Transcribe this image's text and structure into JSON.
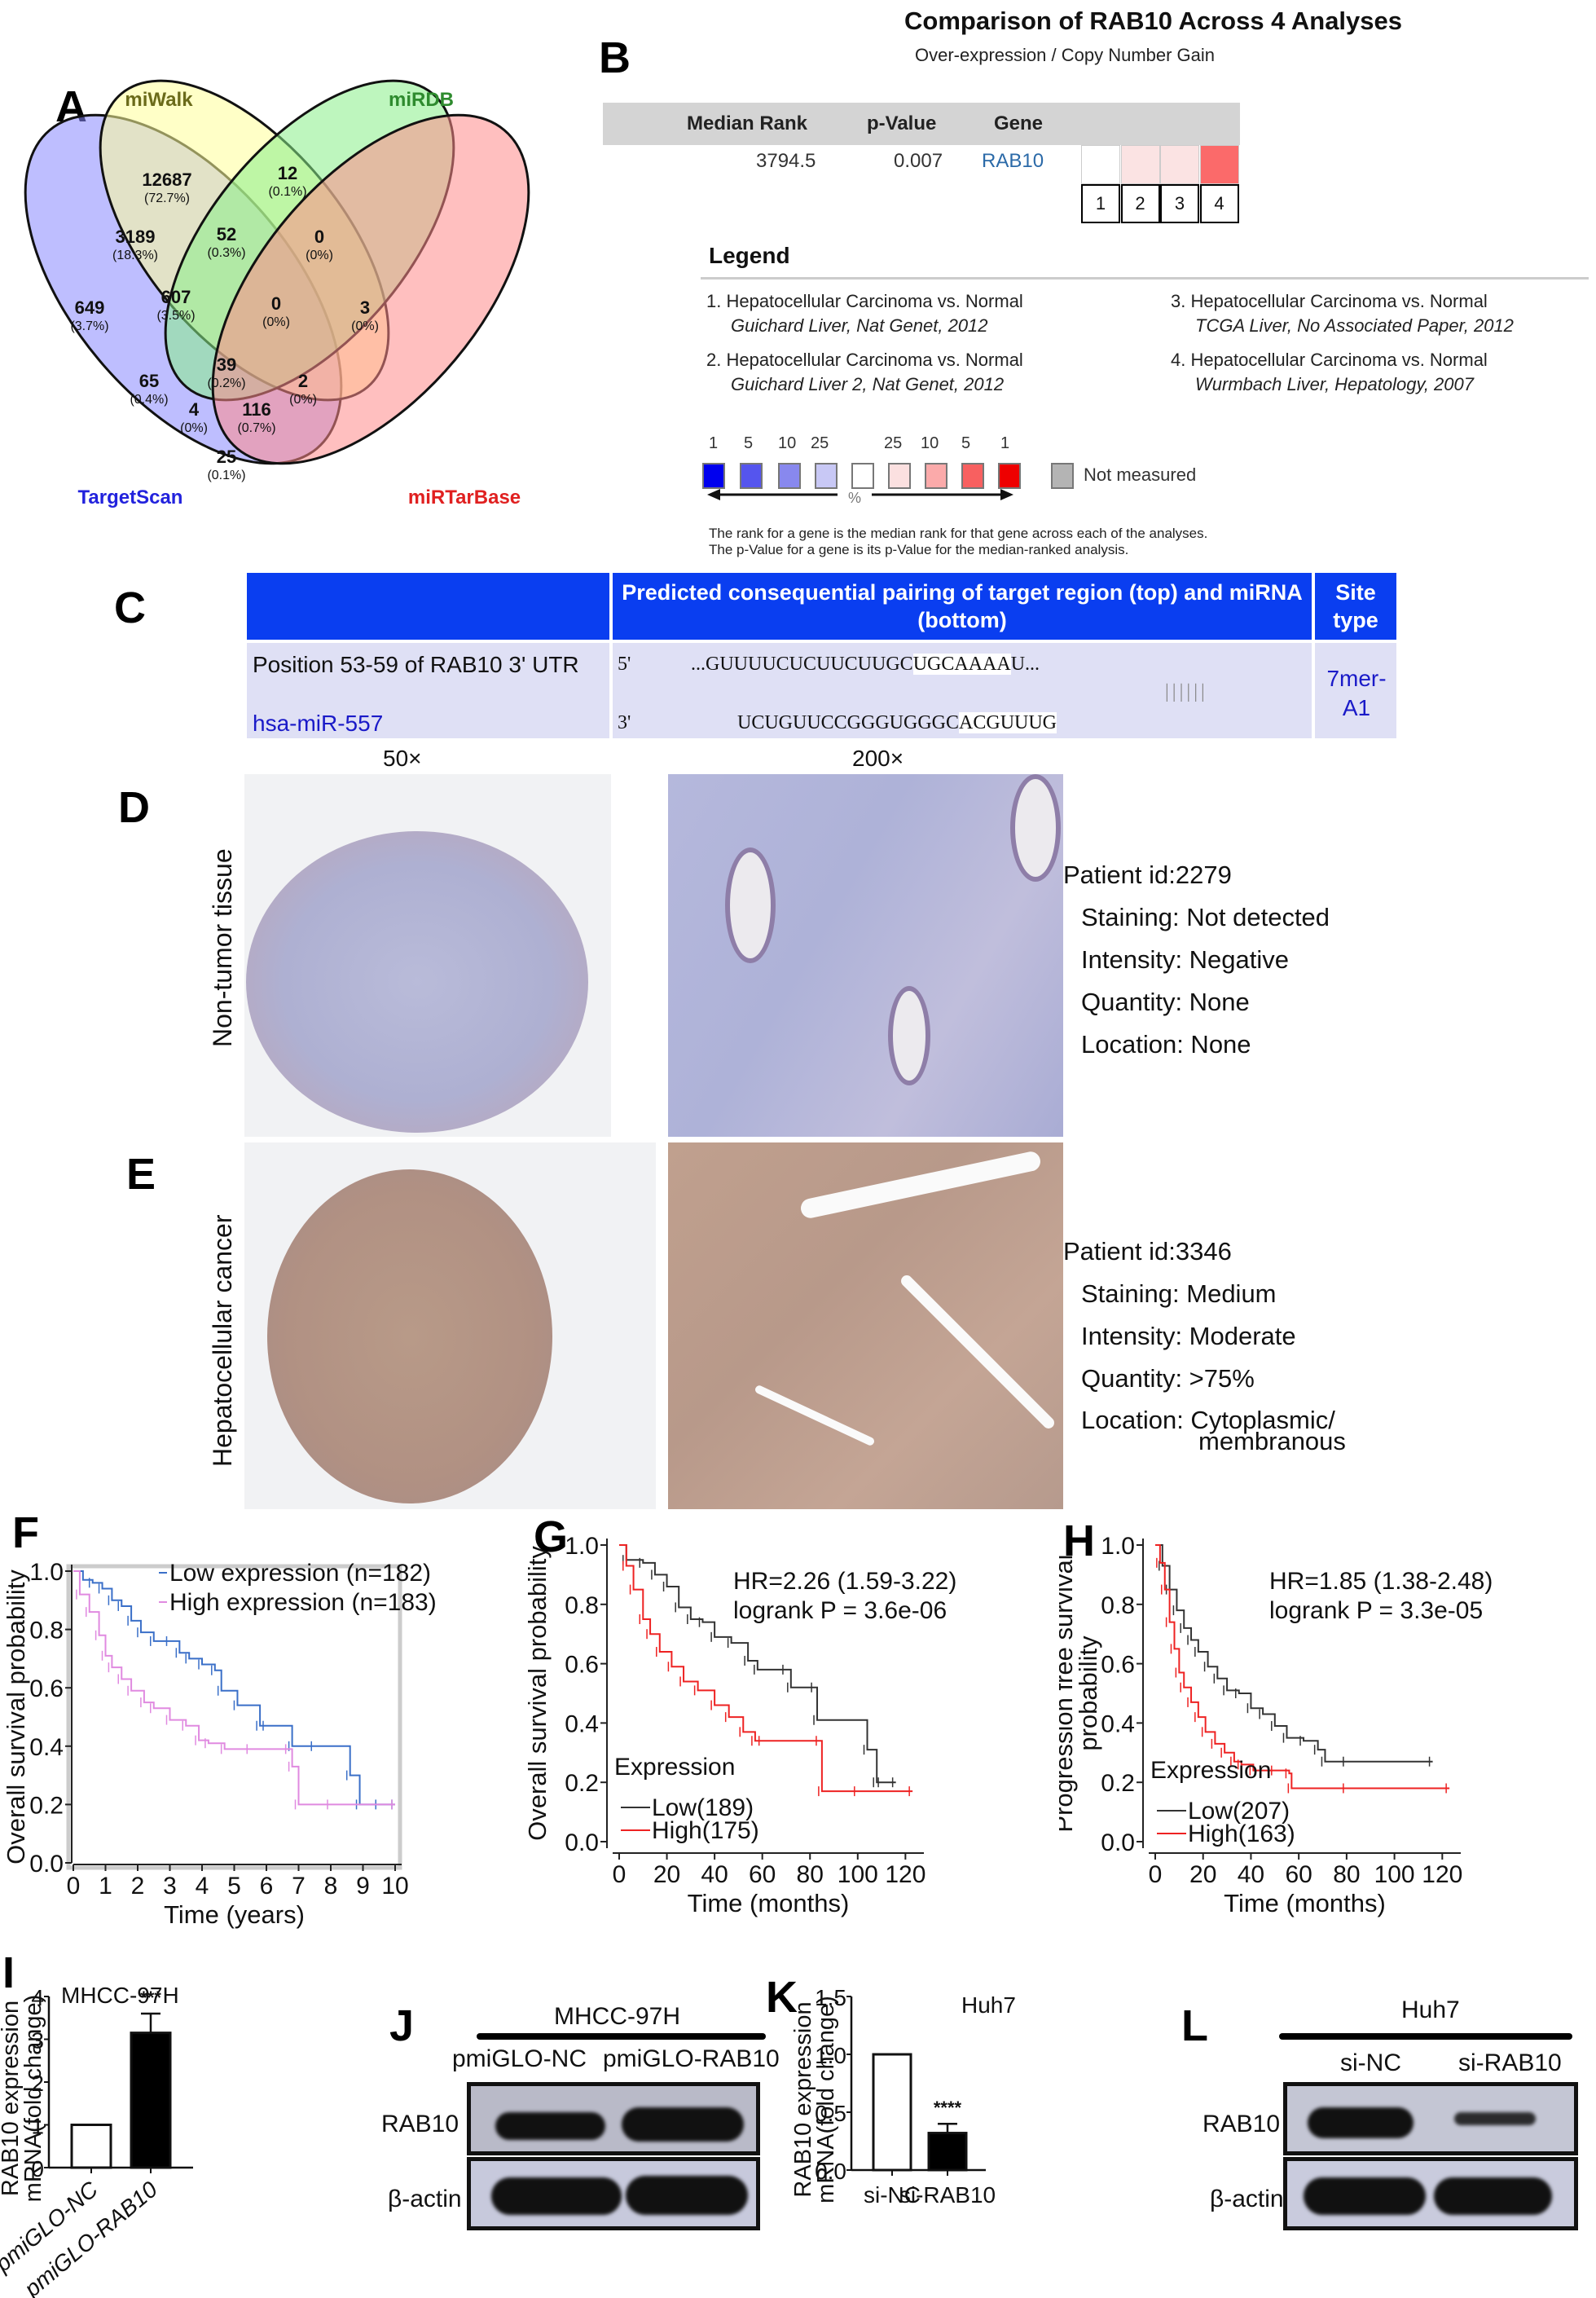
{
  "panel_labels": {
    "A": "A",
    "B": "B",
    "C": "C",
    "D": "D",
    "E": "E",
    "F": "F",
    "G": "G",
    "H": "H",
    "I": "I",
    "J": "J",
    "K": "K",
    "L": "L"
  },
  "venn": {
    "sets": [
      {
        "name": "miWalk",
        "color": "#ffff99",
        "label_color": "#6b6b1a"
      },
      {
        "name": "miRDB",
        "color": "#88ee88",
        "label_color": "#2e8b2e"
      },
      {
        "name": "TargetScan",
        "color": "#8888ff",
        "label_color": "#2222dd"
      },
      {
        "name": "miRTarBase",
        "color": "#ff8a8a",
        "label_color": "#e02020"
      }
    ],
    "regions": [
      {
        "sets": "miWalk only",
        "count": "12687",
        "pct": "(72.7%)"
      },
      {
        "sets": "miRDB only",
        "count": "12",
        "pct": "(0.1%)"
      },
      {
        "sets": "TargetScan only",
        "count": "649",
        "pct": "(3.7%)"
      },
      {
        "sets": "miRTarBase only",
        "count": "3",
        "pct": "(0%)"
      },
      {
        "sets": "TargetScan & miWalk",
        "count": "3189",
        "pct": "(18.3%)"
      },
      {
        "sets": "miWalk & miRDB",
        "count": "52",
        "pct": "(0.3%)"
      },
      {
        "sets": "miRDB & miRTarBase",
        "count": "0",
        "pct": "(0%)"
      },
      {
        "sets": "TargetScan & miWalk & miRDB",
        "count": "607",
        "pct": "(3.5%)"
      },
      {
        "sets": "miWalk & miRDB & miRTarBase",
        "count": "0",
        "pct": "(0%)"
      },
      {
        "sets": "all four",
        "count": "39",
        "pct": "(0.2%)"
      },
      {
        "sets": "TargetScan & miRDB",
        "count": "65",
        "pct": "(0.4%)"
      },
      {
        "sets": "miWalk & miRTarBase",
        "count": "2",
        "pct": "(0%)"
      },
      {
        "sets": "TargetScan & miRDB & miRTarBase",
        "count": "4",
        "pct": "(0%)"
      },
      {
        "sets": "TargetScan & miWalk & miRTarBase",
        "count": "116",
        "pct": "(0.7%)"
      },
      {
        "sets": "TargetScan & miRTarBase",
        "count": "25",
        "pct": "(0.1%)"
      }
    ]
  },
  "oncomine": {
    "title": "Comparison of RAB10 Across 4 Analyses",
    "subtitle": "Over-expression / Copy Number Gain",
    "headers": [
      "Median Rank",
      "p-Value",
      "Gene"
    ],
    "row": {
      "median_rank": "3794.5",
      "p_value": "0.007",
      "gene": "RAB10"
    },
    "cells": [
      {
        "n": "1",
        "color": "#ffffff"
      },
      {
        "n": "2",
        "color": "#fbe3e3"
      },
      {
        "n": "3",
        "color": "#fbe3e3"
      },
      {
        "n": "4",
        "color": "#fb6a6a"
      }
    ],
    "legend_title": "Legend",
    "analyses": [
      {
        "title": "1. Hepatocellular Carcinoma vs. Normal",
        "source": "Guichard Liver, Nat Genet, 2012"
      },
      {
        "title": "2. Hepatocellular Carcinoma vs. Normal",
        "source": "Guichard Liver 2, Nat Genet, 2012"
      },
      {
        "title": "3. Hepatocellular Carcinoma vs. Normal",
        "source": "TCGA Liver, No Associated Paper, 2012"
      },
      {
        "title": "4. Hepatocellular Carcinoma vs. Normal",
        "source": "Wurmbach Liver, Hepatology, 2007"
      }
    ],
    "scale_labels": [
      "1",
      "5",
      "10",
      "25",
      "25",
      "10",
      "5",
      "1"
    ],
    "scale_colors": [
      "#0000ee",
      "#5555ee",
      "#8888ee",
      "#c8c8f5",
      "#ffffff",
      "#fbe0e0",
      "#fbaaaa",
      "#f86060",
      "#ee0000"
    ],
    "not_measured_color": "#b4b4b4",
    "not_measured": "Not measured",
    "percent": "%",
    "note_line1": "The rank for a gene is the median rank for that gene across each of the analyses.",
    "note_line2": "The p-Value for a gene is its p-Value for the median-ranked analysis."
  },
  "targetscan": {
    "header_pairing": "Predicted consequential pairing of target region (top) and miRNA (bottom)",
    "header_site": "Site type",
    "position": "Position 53-59 of RAB10 3' UTR",
    "mirna": "hsa-miR-557",
    "five": "5'",
    "three": "3'",
    "target_pre": "...GUUUUCUCUUCUUGC",
    "target_hl": "UGCAAAA",
    "target_post": "U...",
    "mirna_pre": "UCUGUUCCGGGUGGGC",
    "mirna_hl": "ACGUUUG",
    "pairing": "||||||",
    "site_type": "7mer-A1"
  },
  "ihc": {
    "mag_low": "50×",
    "mag_high": "200×",
    "normal": {
      "row_label": "Non-tumor tissue",
      "patient": "Patient id:2279",
      "staining": "Staining: Not detected",
      "intensity": "Intensity: Negative",
      "quantity": "Quantity: None",
      "location": "Location: None"
    },
    "cancer": {
      "row_label": "Hepatocellular cancer",
      "patient": "Patient id:3346",
      "staining": "Staining: Medium",
      "intensity": "Intensity: Moderate",
      "quantity": "Quantity: >75%",
      "location": "Location: Cytoplasmic/",
      "location2": "membranous"
    }
  },
  "chart_data": [
    {
      "id": "F",
      "type": "line",
      "subtype": "kaplan-meier",
      "title": "",
      "xlabel": "Time (years)",
      "ylabel": "Overall survival probability",
      "xlim": [
        0,
        10
      ],
      "ylim": [
        0,
        1
      ],
      "xticks": [
        "0",
        "1",
        "2",
        "3",
        "4",
        "5",
        "6",
        "7",
        "8",
        "9",
        "10"
      ],
      "yticks": [
        "0.0",
        "0.2",
        "0.4",
        "0.6",
        "0.8",
        "1.0"
      ],
      "legend_position": "top-right",
      "series": [
        {
          "name": "Low expression (n=182)",
          "color": "#3a6fc8",
          "x": [
            0,
            0.3,
            0.6,
            0.9,
            1.2,
            1.5,
            1.8,
            2.1,
            2.5,
            3.0,
            3.3,
            3.6,
            4.0,
            4.4,
            4.6,
            5.1,
            5.8,
            6.0,
            6.8,
            7.5,
            8.6,
            8.9,
            9.5,
            10
          ],
          "y": [
            1.0,
            0.97,
            0.96,
            0.94,
            0.9,
            0.88,
            0.83,
            0.79,
            0.76,
            0.76,
            0.72,
            0.7,
            0.68,
            0.66,
            0.59,
            0.54,
            0.47,
            0.47,
            0.4,
            0.4,
            0.3,
            0.2,
            0.2,
            0.2
          ]
        },
        {
          "name": "High expression (n=183)",
          "color": "#e08ae0",
          "x": [
            0,
            0.2,
            0.5,
            0.8,
            1.0,
            1.2,
            1.5,
            1.8,
            2.2,
            2.5,
            3.0,
            3.5,
            3.9,
            4.2,
            4.7,
            5.5,
            6.7,
            6.8,
            7.0,
            8.0,
            10
          ],
          "y": [
            1.0,
            0.92,
            0.86,
            0.78,
            0.71,
            0.67,
            0.63,
            0.59,
            0.55,
            0.53,
            0.49,
            0.47,
            0.42,
            0.41,
            0.39,
            0.39,
            0.39,
            0.33,
            0.2,
            0.2,
            0.2
          ]
        }
      ]
    },
    {
      "id": "G",
      "type": "line",
      "subtype": "kaplan-meier",
      "xlabel": "Time (months)",
      "ylabel": "Overall survival probability",
      "xlim": [
        0,
        125
      ],
      "ylim": [
        0,
        1
      ],
      "xticks": [
        "0",
        "20",
        "40",
        "60",
        "80",
        "100",
        "120"
      ],
      "yticks": [
        "0.0",
        "0.2",
        "0.4",
        "0.6",
        "0.8",
        "1.0"
      ],
      "annotation_hr": "HR=2.26 (1.59-3.22)",
      "annotation_p": "logrank P = 3.6e-06",
      "legend_title": "Expression",
      "legend_position": "bottom-left",
      "series": [
        {
          "name": "Low(189)",
          "color": "#333333",
          "x": [
            0,
            3,
            10,
            15,
            20,
            25,
            30,
            35,
            40,
            47,
            54,
            58,
            70,
            72,
            82,
            83,
            104,
            108,
            110,
            116
          ],
          "y": [
            1.0,
            0.95,
            0.94,
            0.9,
            0.86,
            0.79,
            0.75,
            0.74,
            0.69,
            0.67,
            0.61,
            0.58,
            0.58,
            0.52,
            0.52,
            0.41,
            0.31,
            0.2,
            0.2,
            0.2
          ]
        },
        {
          "name": "High(175)",
          "color": "#ee2222",
          "x": [
            0,
            3,
            6,
            10,
            13,
            17,
            22,
            27,
            33,
            40,
            46,
            52,
            57,
            60,
            84,
            85,
            100,
            123
          ],
          "y": [
            1.0,
            0.93,
            0.85,
            0.75,
            0.7,
            0.64,
            0.59,
            0.54,
            0.51,
            0.46,
            0.42,
            0.37,
            0.34,
            0.34,
            0.34,
            0.17,
            0.17,
            0.17
          ]
        }
      ]
    },
    {
      "id": "H",
      "type": "line",
      "subtype": "kaplan-meier",
      "xlabel": "Time (months)",
      "ylabel": "Progression free survival probability",
      "xlim": [
        0,
        125
      ],
      "ylim": [
        0,
        1
      ],
      "xticks": [
        "0",
        "20",
        "40",
        "60",
        "80",
        "100",
        "120"
      ],
      "yticks": [
        "0.0",
        "0.2",
        "0.4",
        "0.6",
        "0.8",
        "1.0"
      ],
      "annotation_hr": "HR=1.85 (1.38-2.48)",
      "annotation_p": "logrank P = 3.3e-05",
      "legend_title": "Expression",
      "legend_position": "bottom-left",
      "series": [
        {
          "name": "Low(207)",
          "color": "#333333",
          "x": [
            0,
            3,
            6,
            9,
            12,
            15,
            18,
            22,
            26,
            30,
            35,
            40,
            45,
            50,
            55,
            62,
            68,
            71,
            80,
            116
          ],
          "y": [
            1.0,
            0.93,
            0.85,
            0.78,
            0.72,
            0.68,
            0.64,
            0.59,
            0.55,
            0.51,
            0.5,
            0.45,
            0.43,
            0.39,
            0.35,
            0.34,
            0.31,
            0.27,
            0.27,
            0.27
          ]
        },
        {
          "name": "High(163)",
          "color": "#ee2222",
          "x": [
            0,
            2,
            4,
            6,
            8,
            10,
            12,
            15,
            18,
            21,
            25,
            29,
            33,
            36,
            41,
            50,
            56,
            57,
            80,
            123
          ],
          "y": [
            1.0,
            0.94,
            0.85,
            0.74,
            0.65,
            0.57,
            0.52,
            0.47,
            0.42,
            0.37,
            0.33,
            0.3,
            0.27,
            0.26,
            0.24,
            0.24,
            0.23,
            0.18,
            0.18,
            0.18
          ]
        }
      ]
    },
    {
      "id": "I",
      "type": "bar",
      "title": "MHCC-97H",
      "ylabel": "RAB10 expression mRNA(fold change)",
      "categories": [
        "pmiGLO-NC",
        "pmiGLO-RAB10"
      ],
      "values": [
        1.0,
        3.15
      ],
      "errors": [
        0,
        0.45
      ],
      "fills": [
        "#ffffff",
        "#000000"
      ],
      "significance": [
        "",
        "***"
      ],
      "ylim": [
        0,
        4
      ],
      "yticks": [
        "0",
        "1",
        "2",
        "3",
        "4"
      ]
    },
    {
      "id": "K",
      "type": "bar",
      "title": "Huh7",
      "ylabel": "RAB10 expression mRNA(fold change)",
      "categories": [
        "si-NC",
        "si-RAB10"
      ],
      "values": [
        1.0,
        0.32
      ],
      "errors": [
        0,
        0.08
      ],
      "fills": [
        "#ffffff",
        "#000000"
      ],
      "significance": [
        "",
        "****"
      ],
      "ylim": [
        0,
        1.5
      ],
      "yticks": [
        "0.0",
        "0.5",
        "1.0",
        "1.5"
      ]
    }
  ],
  "western_J": {
    "cell_line": "MHCC-97H",
    "lanes": [
      "pmiGLO-NC",
      "pmiGLO-RAB10"
    ],
    "rows": [
      "RAB10",
      "β-actin"
    ]
  },
  "western_L": {
    "cell_line": "Huh7",
    "lanes": [
      "si-NC",
      "si-RAB10"
    ],
    "rows": [
      "RAB10",
      "β-actin"
    ]
  }
}
